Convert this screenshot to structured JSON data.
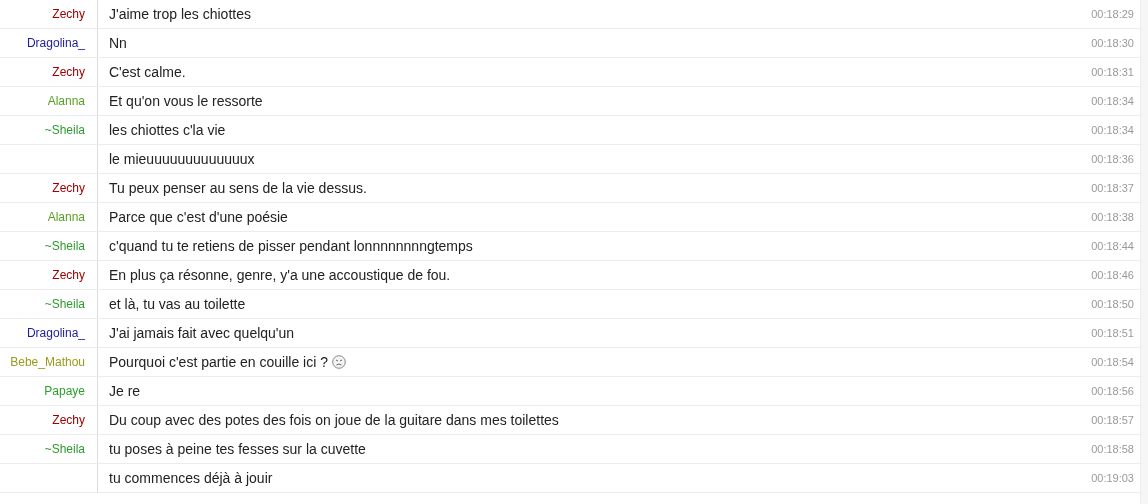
{
  "messages": [
    {
      "nick": "Zechy",
      "color": "#a00000",
      "text": "J'aime trop les chiottes",
      "time": "00:18:29",
      "emoji": false
    },
    {
      "nick": "Dragolina_",
      "color": "#1c1c9c",
      "text": "Nn",
      "time": "00:18:30",
      "emoji": false
    },
    {
      "nick": "Zechy",
      "color": "#a00000",
      "text": "C'est calme.",
      "time": "00:18:31",
      "emoji": false
    },
    {
      "nick": "Alanna",
      "color": "#5b9e26",
      "text": "Et qu'on vous le ressorte",
      "time": "00:18:34",
      "emoji": false
    },
    {
      "nick": "~Sheila",
      "color": "#2f9a2f",
      "text": "les chiottes c'la vie",
      "time": "00:18:34",
      "emoji": false
    },
    {
      "text": "le mieuuuuuuuuuuuuux",
      "time": "00:18:36",
      "emoji": false
    },
    {
      "nick": "Zechy",
      "color": "#a00000",
      "text": "Tu peux penser au sens de la vie dessus.",
      "time": "00:18:37",
      "emoji": false
    },
    {
      "nick": "Alanna",
      "color": "#5b9e26",
      "text": "Parce que c'est d'une poésie",
      "time": "00:18:38",
      "emoji": false
    },
    {
      "nick": "~Sheila",
      "color": "#2f9a2f",
      "text": "c'quand tu te retiens de pisser pendant lonnnnnnnngtemps",
      "time": "00:18:44",
      "emoji": false
    },
    {
      "nick": "Zechy",
      "color": "#a00000",
      "text": "En plus ça résonne, genre, y'a une accoustique de fou.",
      "time": "00:18:46",
      "emoji": false
    },
    {
      "nick": "~Sheila",
      "color": "#2f9a2f",
      "text": "et là, tu vas au toilette",
      "time": "00:18:50",
      "emoji": false
    },
    {
      "nick": "Dragolina_",
      "color": "#1c1c9c",
      "text": "J'ai jamais fait avec quelqu'un",
      "time": "00:18:51",
      "emoji": false
    },
    {
      "nick": "Bebe_Mathou",
      "color": "#9a9a1c",
      "text": "Pourquoi c'est partie en couille ici ?",
      "time": "00:18:54",
      "emoji": true
    },
    {
      "nick": "Papaye",
      "color": "#2ca02c",
      "text": "Je re",
      "time": "00:18:56",
      "emoji": false
    },
    {
      "nick": "Zechy",
      "color": "#a00000",
      "text": "Du coup avec des potes des fois on joue de la guitare dans mes toilettes",
      "time": "00:18:57",
      "emoji": false
    },
    {
      "nick": "~Sheila",
      "color": "#2f9a2f",
      "text": "tu poses à peine tes fesses sur la cuvette",
      "time": "00:18:58",
      "emoji": false
    },
    {
      "text": "tu commences déjà à jouir",
      "time": "00:19:03",
      "emoji": false
    }
  ]
}
